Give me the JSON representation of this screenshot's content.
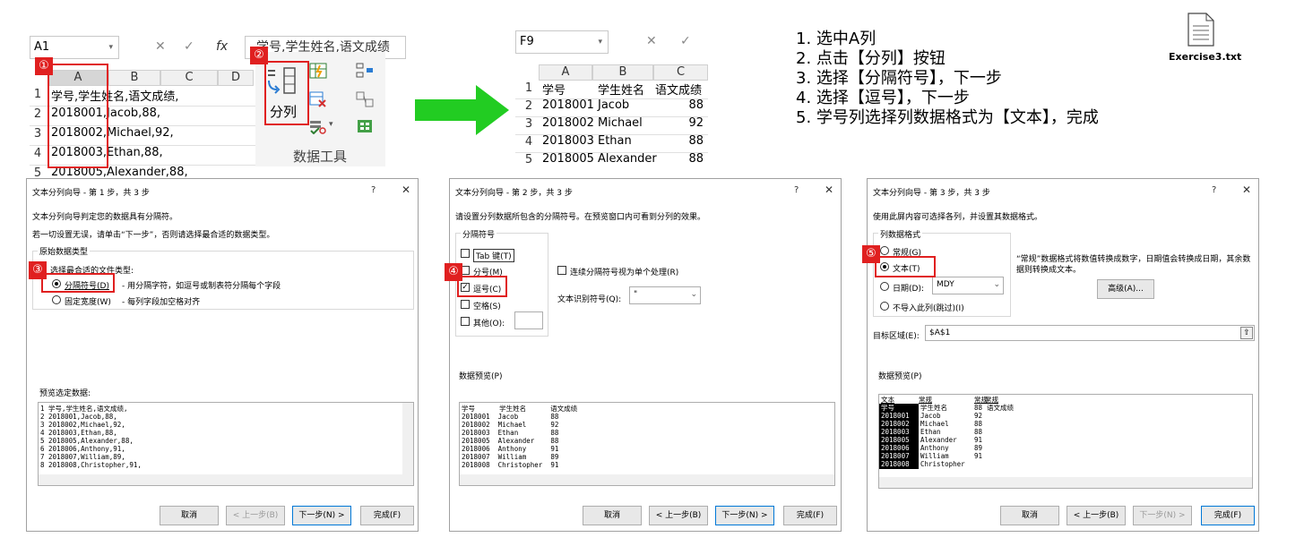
{
  "excel1": {
    "namebox": "A1",
    "fx": "fx",
    "formula": "学号,学生姓名,语文成绩",
    "cols": [
      "A",
      "B",
      "C",
      "D"
    ],
    "rows": [
      {
        "n": "1",
        "v": "学号,学生姓名,语文成绩,"
      },
      {
        "n": "2",
        "v": "2018001,Jacob,88,"
      },
      {
        "n": "3",
        "v": "2018002,Michael,92,"
      },
      {
        "n": "4",
        "v": "2018003,Ethan,88,"
      },
      {
        "n": "5",
        "v": "2018005,Alexander,88,"
      }
    ],
    "badge1": "①"
  },
  "ribbon": {
    "split_label": "分列",
    "group_label": "数据工具",
    "badge2": "②"
  },
  "excel2": {
    "namebox": "F9",
    "cols": [
      "A",
      "B",
      "C"
    ],
    "rows": [
      {
        "n": "1",
        "a": "学号",
        "b": "学生姓名",
        "c": "语文成绩"
      },
      {
        "n": "2",
        "a": "2018001",
        "b": "Jacob",
        "c": "88"
      },
      {
        "n": "3",
        "a": "2018002",
        "b": "Michael",
        "c": "92"
      },
      {
        "n": "4",
        "a": "2018003",
        "b": "Ethan",
        "c": "88"
      },
      {
        "n": "5",
        "a": "2018005",
        "b": "Alexander",
        "c": "88"
      }
    ]
  },
  "steps": [
    "1.  选中A列",
    "2.  点击【分列】按钮",
    "3.  选择【分隔符号】，下一步",
    "4.  选择【逗号】，下一步",
    "5.  学号列选择列数据格式为【文本】，完成"
  ],
  "file": {
    "name": "Exercise3.txt"
  },
  "dialog1": {
    "title": "文本分列向导 - 第 1 步，共 3 步",
    "q": "?",
    "x": "✕",
    "line1": "文本分列向导判定您的数据具有分隔符。",
    "line2": "若一切设置无误，请单击“下一步”，否则请选择最合适的数据类型。",
    "group": "原始数据类型",
    "prompt": "选择最合适的文件类型:",
    "opt1": "分隔符号(D)",
    "opt1_desc": "- 用分隔字符，如逗号或制表符分隔每个字段",
    "opt2": "固定宽度(W)",
    "opt2_desc": "- 每列字段加空格对齐",
    "preview_label": "预览选定数据:",
    "preview": [
      "1 学号,学生姓名,语文成绩,",
      "2 2018001,Jacob,88,",
      "3 2018002,Michael,92,",
      "4 2018003,Ethan,88,",
      "5 2018005,Alexander,88,",
      "6 2018006,Anthony,91,",
      "7 2018007,William,89,",
      "8 2018008,Christopher,91,"
    ],
    "badge3": "③",
    "cancel": "取消",
    "back": "< 上一步(B)",
    "next": "下一步(N) >",
    "finish": "完成(F)"
  },
  "dialog2": {
    "title": "文本分列向导 - 第 2 步，共 3 步",
    "q": "?",
    "x": "✕",
    "line1": "请设置分列数据所包含的分隔符号。在预览窗口内可看到分列的效果。",
    "group": "分隔符号",
    "tab": "Tab 键(T)",
    "semicolon": "分号(M)",
    "comma": "逗号(C)",
    "space": "空格(S)",
    "other": "其他(O):",
    "consecutive": "连续分隔符号视为单个处理(R)",
    "qualifier_label": "文本识别符号(Q):",
    "qualifier_value": "\"",
    "preview_label": "数据预览(P)",
    "preview": [
      "学号      学生姓名      语文成绩",
      "2018001  Jacob        88",
      "2018002  Michael      92",
      "2018003  Ethan        88",
      "2018005  Alexander    88",
      "2018006  Anthony      91",
      "2018007  William      89",
      "2018008  Christopher  91"
    ],
    "badge4": "④",
    "cancel": "取消",
    "back": "< 上一步(B)",
    "next": "下一步(N) >",
    "finish": "完成(F)"
  },
  "dialog3": {
    "title": "文本分列向导 - 第 3 步，共 3 步",
    "q": "?",
    "x": "✕",
    "line1": "使用此屏内容可选择各列，并设置其数据格式。",
    "group": "列数据格式",
    "general": "常规(G)",
    "text": "文本(T)",
    "date": "日期(D):",
    "date_value": "MDY",
    "skip": "不导入此列(跳过)(I)",
    "desc": "“常规”数据格式将数值转换成数字，日期值会转换成日期，其余数据则转换成文本。",
    "advanced": "高级(A)...",
    "target_label": "目标区域(E):",
    "target_value": "$A$1",
    "preview_label": "数据预览(P)",
    "headers": [
      "文本",
      "常规",
      "常规",
      "常规"
    ],
    "col1": [
      "学号",
      "2018001",
      "2018002",
      "2018003",
      "2018005",
      "2018006",
      "2018007",
      "2018008"
    ],
    "col2": [
      "学生姓名",
      "Jacob",
      "Michael",
      "Ethan",
      "Alexander",
      "Anthony",
      "William",
      "Christopher"
    ],
    "col3": [
      "",
      "88",
      "92",
      "88",
      "88",
      "91",
      "89",
      "91"
    ],
    "col4": [
      "语文成绩",
      "",
      "",
      "",
      "",
      "",
      "",
      ""
    ],
    "badge5": "⑤",
    "cancel": "取消",
    "back": "< 上一步(B)",
    "next": "下一步(N) >",
    "finish": "完成(F)"
  }
}
